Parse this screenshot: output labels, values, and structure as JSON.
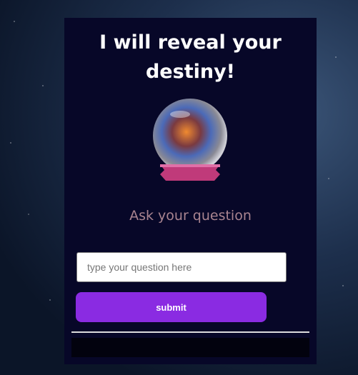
{
  "header": {
    "title": "I will reveal your destiny!"
  },
  "image": {
    "icon": "crystal-ball"
  },
  "form": {
    "heading": "Ask your question",
    "placeholder": "type your question here",
    "value": "",
    "submit_label": "submit"
  },
  "colors": {
    "card": "#070728",
    "button": "#8a2be2",
    "heading": "#a98490"
  }
}
